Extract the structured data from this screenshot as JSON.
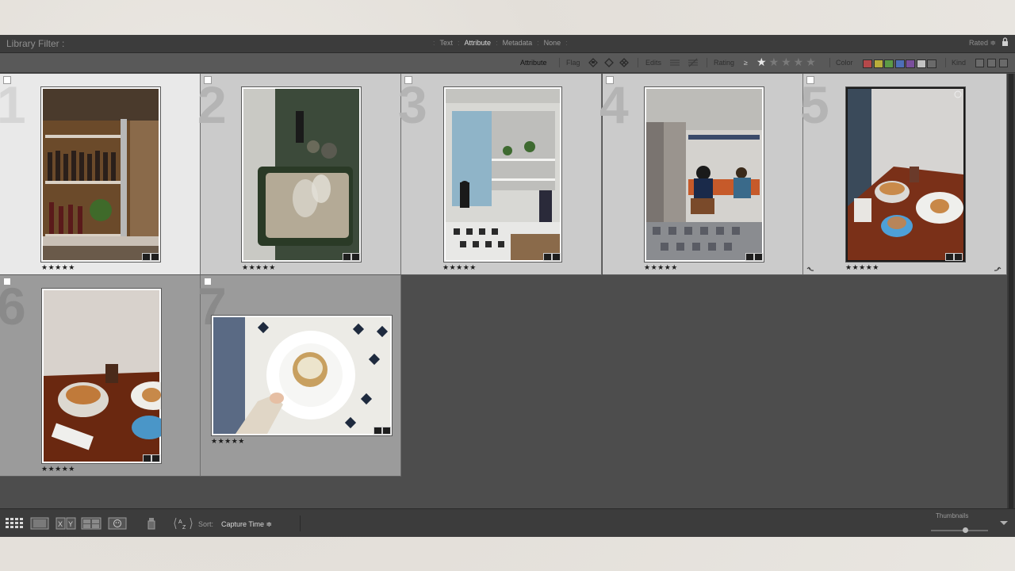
{
  "library_filter": {
    "title": "Library Filter :",
    "tabs": [
      "Text",
      "Attribute",
      "Metadata",
      "None"
    ],
    "active_tab": "Attribute",
    "preset": "Rated ≑"
  },
  "attribute_bar": {
    "label": "Attribute",
    "flag_label": "Flag",
    "edits_label": "Edits",
    "rating_label": "Rating",
    "rating_op": "≥",
    "rating_value_stars": 1,
    "color_label": "Color",
    "kind_label": "Kind",
    "color_swatches": [
      "#b5484a",
      "#b9ad3b",
      "#5c9a46",
      "#4e6fb8",
      "#7a4f9c",
      "#c2c2c2",
      "#6a6a6a"
    ]
  },
  "grid": {
    "cells": [
      {
        "number": "1",
        "stars": "★★★★★"
      },
      {
        "number": "2",
        "stars": "★★★★★"
      },
      {
        "number": "3",
        "stars": "★★★★★"
      },
      {
        "number": "4",
        "stars": "★★★★★"
      },
      {
        "number": "5",
        "stars": "★★★★★"
      },
      {
        "number": "6",
        "stars": "★★★★★"
      },
      {
        "number": "7",
        "stars": "★★★★★"
      }
    ]
  },
  "toolbar": {
    "sort_label": "Sort:",
    "sort_value": "Capture Time ≑",
    "thumbnails_label": "Thumbnails",
    "thumbnail_size": 0.6,
    "sort_order_glyph": "AZ"
  }
}
